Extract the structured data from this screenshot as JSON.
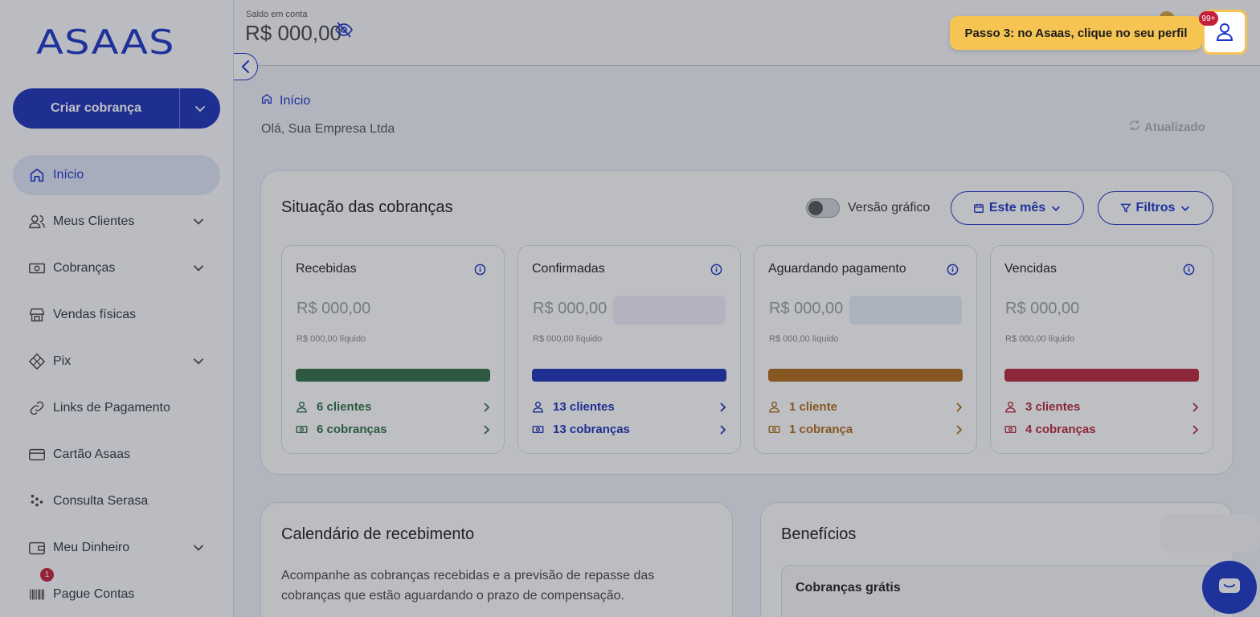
{
  "brand": {
    "logo": "ASAAS",
    "accent": "#1a35c8"
  },
  "header": {
    "balance_label": "Saldo em conta",
    "balance": "R$ 000,00",
    "notifications_badge": "99+",
    "tooltip": "Passo 3: no Asaas, clique no seu perfil"
  },
  "sidebar": {
    "create_label": "Criar cobrança",
    "items": [
      {
        "label": "Início",
        "icon": "home-icon"
      },
      {
        "label": "Meus Clientes",
        "icon": "users-icon"
      },
      {
        "label": "Cobranças",
        "icon": "money-icon"
      },
      {
        "label": "Vendas físicas",
        "icon": "store-icon"
      },
      {
        "label": "Pix",
        "icon": "pix-icon"
      },
      {
        "label": "Links de Pagamento",
        "icon": "link-icon"
      },
      {
        "label": "Cartão Asaas",
        "icon": "card-icon"
      },
      {
        "label": "Consulta Serasa",
        "icon": "serasa-icon"
      },
      {
        "label": "Meu Dinheiro",
        "icon": "wallet-icon"
      },
      {
        "label": "Pague Contas",
        "icon": "barcode-icon",
        "badge": "1"
      }
    ]
  },
  "main": {
    "breadcrumb": "Início",
    "greeting": "Olá, Sua Empresa Ltda",
    "updated": "Atualizado",
    "situacao": {
      "title": "Situação das cobranças",
      "toggle_label": "Versão gráfico",
      "period_button": "Este mês",
      "filter_button": "Filtros",
      "cards": [
        {
          "title": "Recebidas",
          "amount": "R$ 000,00",
          "liquid": "R$ 000,00 líquido",
          "color": "#2e6e44",
          "clients": "6 clientes",
          "charges": "6 cobranças"
        },
        {
          "title": "Confirmadas",
          "amount": "R$ 000,00",
          "liquid": "R$ 000,00 líquido",
          "color": "#1a32b8",
          "clients": "13 clientes",
          "charges": "13 cobranças"
        },
        {
          "title": "Aguardando pagamento",
          "amount": "R$ 000,00",
          "liquid": "R$ 000,00 líquido",
          "color": "#b06a1a",
          "clients": "1 cliente",
          "charges": "1 cobrança"
        },
        {
          "title": "Vencidas",
          "amount": "R$ 000,00",
          "liquid": "R$ 000,00 líquido",
          "color": "#b8253a",
          "clients": "3 clientes",
          "charges": "4 cobranças"
        }
      ]
    },
    "calendario": {
      "title": "Calendário de recebimento",
      "description": "Acompanhe as cobranças recebidas e a previsão de repasse das cobranças que estão aguardando o prazo de compensação."
    },
    "beneficios": {
      "title": "Benefícios",
      "item_title": "Cobranças grátis"
    }
  }
}
